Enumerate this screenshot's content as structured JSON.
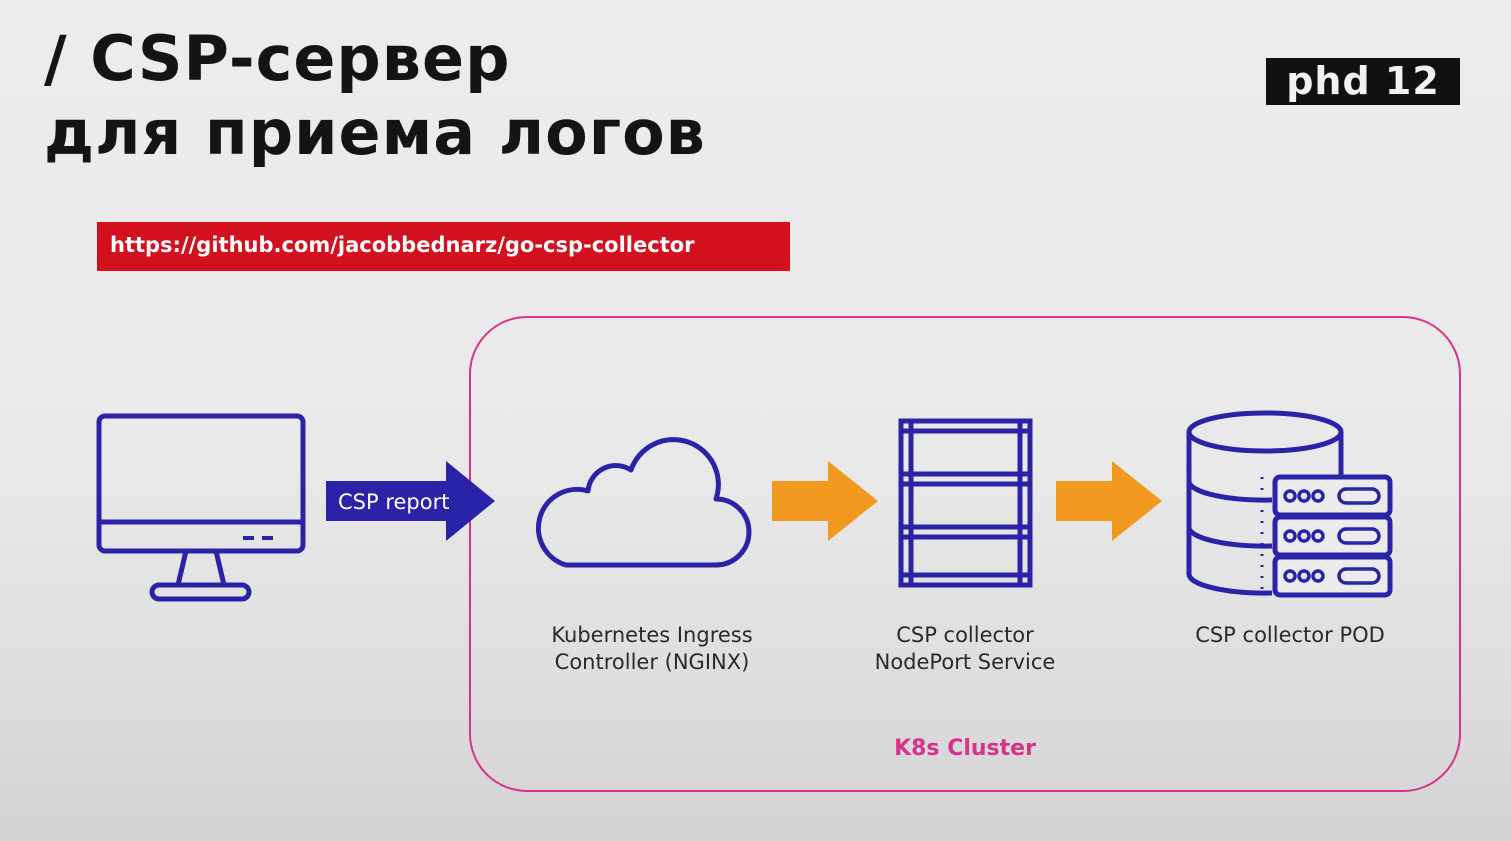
{
  "title": {
    "line1": "/ CSP-сервер",
    "line2": "для приема логов"
  },
  "logo": {
    "text": "phd 12"
  },
  "url": "https://github.com/jacobbednarz/go-csp-collector",
  "diagram": {
    "report_label": "CSP report",
    "cluster_label": "K8s Cluster",
    "nodes": [
      {
        "id": "ingress",
        "label": "Kubernetes Ingress\nController (NGINX)",
        "icon": "cloud-icon"
      },
      {
        "id": "service",
        "label": "CSP collector\nNodePort Service",
        "icon": "rack-icon"
      },
      {
        "id": "pod",
        "label": "CSP collector POD",
        "icon": "database-server-icon"
      }
    ],
    "client_icon": "monitor-icon",
    "colors": {
      "icon": "#2a23a8",
      "arrow_orange": "#f29a1f",
      "cluster_border": "#d8328c",
      "url_bg": "#d2101e"
    }
  }
}
